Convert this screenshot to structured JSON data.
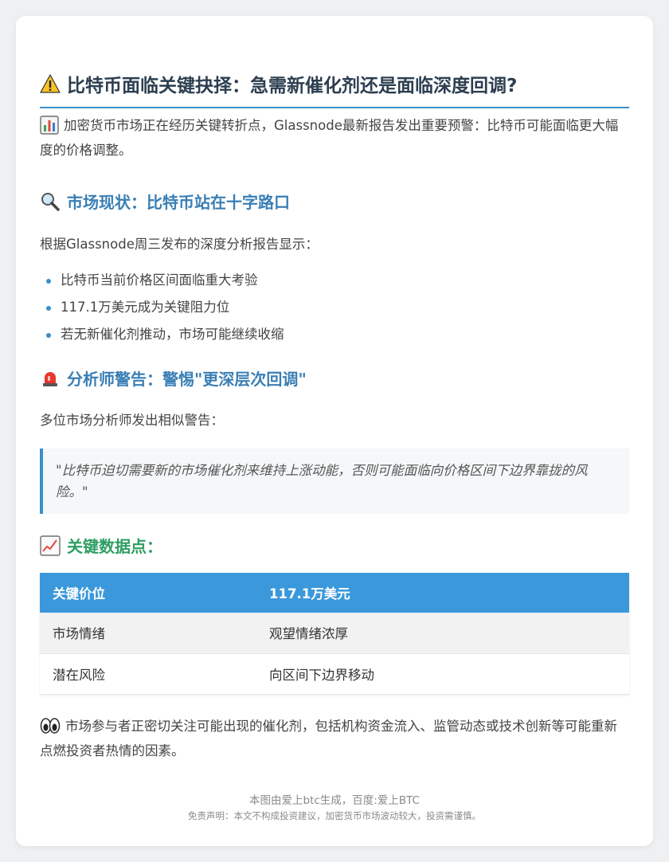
{
  "header": {
    "title": "比特币面临关键抉择：急需新催化剂还是面临深度回调?",
    "title_icon": "warning-icon"
  },
  "intro": {
    "icon": "bar-chart-icon",
    "text": "加密货币市场正在经历关键转折点，Glassnode最新报告发出重要预警：比特币可能面临更大幅度的价格调整。"
  },
  "section1": {
    "icon": "magnifier-icon",
    "heading": "市场现状：比特币站在十字路口",
    "lead": "根据Glassnode周三发布的深度分析报告显示：",
    "bullets": [
      "比特币当前价格区间面临重大考验",
      "117.1万美元成为关键阻力位",
      "若无新催化剂推动，市场可能继续收缩"
    ]
  },
  "section2": {
    "icon": "siren-icon",
    "heading": "分析师警告：警惕\"更深层次回调\"",
    "lead": "多位市场分析师发出相似警告：",
    "quote": "\"比特币迫切需要新的市场催化剂来维持上涨动能，否则可能面临向价格区间下边界靠拢的风险。\""
  },
  "section3": {
    "icon": "trend-chart-icon",
    "heading": "关键数据点：",
    "table": {
      "header": [
        "关键价位",
        "117.1万美元"
      ],
      "rows": [
        [
          "市场情绪",
          "观望情绪浓厚"
        ],
        [
          "潜在风险",
          "向区间下边界移动"
        ]
      ]
    }
  },
  "closing": {
    "icon": "eyes-icon",
    "text": "市场参与者正密切关注可能出现的催化剂，包括机构资金流入、监管动态或技术创新等可能重新点燃投资者热情的因素。"
  },
  "footer": {
    "line1": "本图由爱上btc生成，百度:爱上BTC",
    "line2": "免责声明：本文不构成投资建议，加密货币市场波动较大，投资需谨慎。"
  },
  "colors": {
    "accent": "#3a8fcb",
    "heading_blue": "#3a7fb5",
    "heading_green": "#2e9e63",
    "table_header": "#3a98db"
  }
}
